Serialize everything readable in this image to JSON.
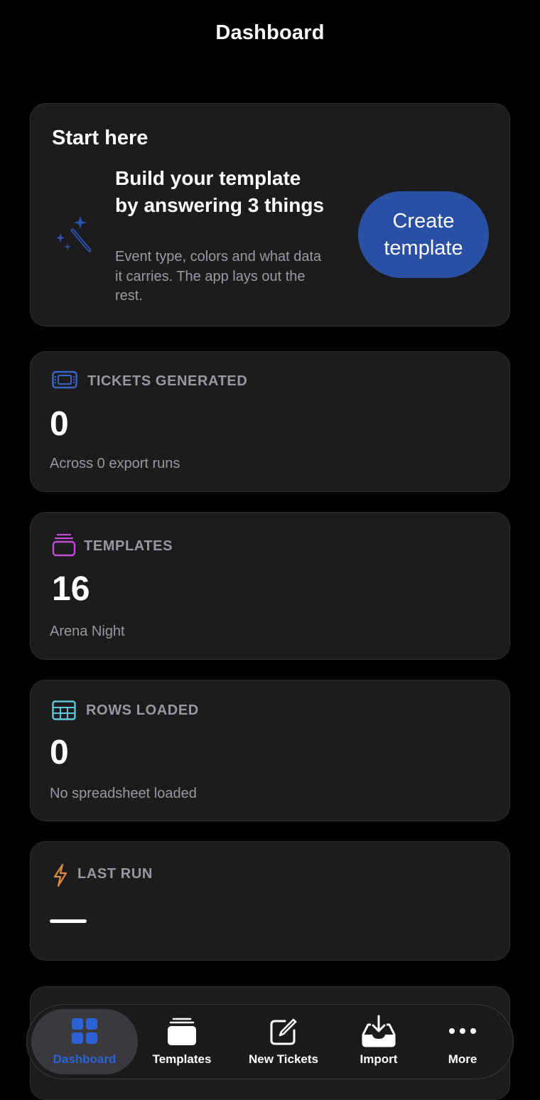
{
  "header": {
    "title": "Dashboard"
  },
  "start_card": {
    "heading": "Start here",
    "title": "Build your template by answering 3 things",
    "description": "Event type, colors and what data it carries. The app lays out the rest.",
    "button_label": "Create template",
    "icon": "magic-wand-icon"
  },
  "stats": {
    "tickets": {
      "label": "TICKETS GENERATED",
      "value": "0",
      "subtitle": "Across 0 export runs",
      "icon": "ticket-icon",
      "color": "#3a63c7"
    },
    "templates": {
      "label": "TEMPLATES",
      "value": "16",
      "subtitle": "Arena Night",
      "icon": "stack-icon",
      "color": "#c04ad6"
    },
    "rows": {
      "label": "ROWS LOADED",
      "value": "0",
      "subtitle": "No spreadsheet loaded",
      "icon": "table-icon",
      "color": "#5ec8d8"
    },
    "last_run": {
      "label": "LAST RUN",
      "icon": "bolt-icon",
      "color": "#e08a3c"
    }
  },
  "tabbar": {
    "items": [
      {
        "label": "Dashboard",
        "icon": "grid-icon",
        "active": true
      },
      {
        "label": "Templates",
        "icon": "stack-icon",
        "active": false
      },
      {
        "label": "New Tickets",
        "icon": "compose-icon",
        "active": false
      },
      {
        "label": "Import",
        "icon": "tray-download-icon",
        "active": false
      },
      {
        "label": "More",
        "icon": "ellipsis-icon",
        "active": false
      }
    ]
  },
  "colors": {
    "accent": "#2a50a6",
    "active_tab": "#2c63d6",
    "card_bg": "#1c1c1e",
    "background": "#000000"
  }
}
